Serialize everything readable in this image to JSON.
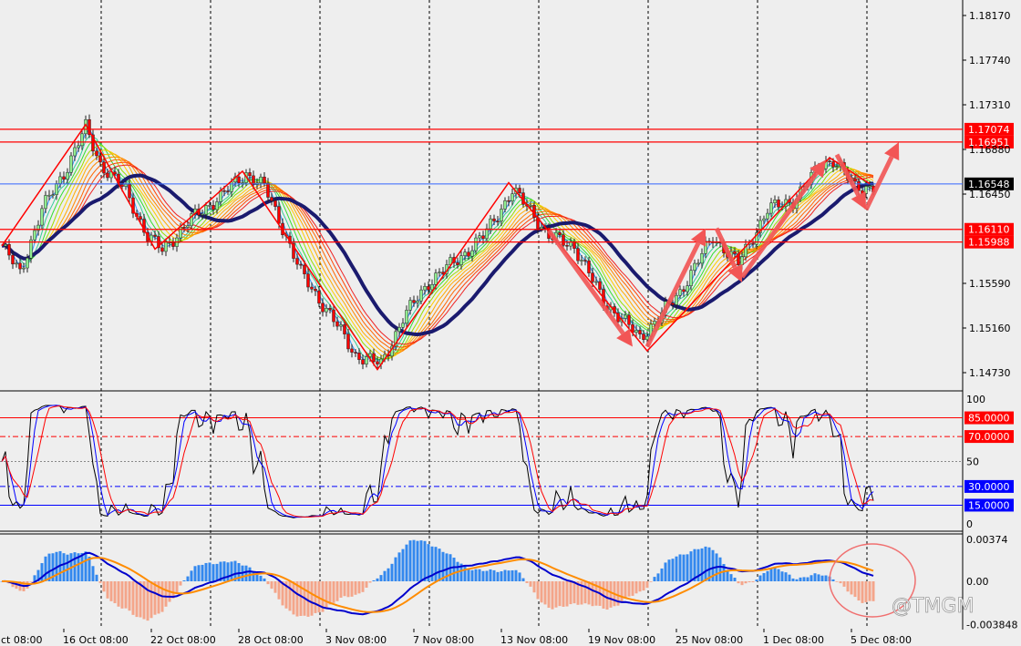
{
  "chart_data": [
    {
      "type": "candlestick",
      "panel": "price",
      "x_unit": "4-hour bar index",
      "y_ticks": [
        "1.18170",
        "1.17740",
        "1.17310",
        "1.16880",
        "1.16450",
        "1.15590",
        "1.15160",
        "1.14730"
      ],
      "ylim": [
        1.144,
        1.185
      ],
      "close_path": [
        [
          0,
          1.1595
        ],
        [
          5,
          1.1569
        ],
        [
          11,
          1.163
        ],
        [
          17,
          1.1665
        ],
        [
          23,
          1.1709
        ],
        [
          27,
          1.1674
        ],
        [
          34,
          1.1648
        ],
        [
          40,
          1.1604
        ],
        [
          44,
          1.1591
        ],
        [
          52,
          1.1621
        ],
        [
          60,
          1.1643
        ],
        [
          67,
          1.1665
        ],
        [
          72,
          1.1652
        ],
        [
          77,
          1.1613
        ],
        [
          82,
          1.1569
        ],
        [
          90,
          1.1529
        ],
        [
          97,
          1.149
        ],
        [
          104,
          1.1481
        ],
        [
          110,
          1.1525
        ],
        [
          117,
          1.156
        ],
        [
          125,
          1.1582
        ],
        [
          132,
          1.1604
        ],
        [
          140,
          1.1648
        ],
        [
          145,
          1.163
        ],
        [
          150,
          1.1604
        ],
        [
          157,
          1.1595
        ],
        [
          165,
          1.1542
        ],
        [
          175,
          1.1507
        ],
        [
          180,
          1.1525
        ],
        [
          186,
          1.1551
        ],
        [
          195,
          1.1604
        ],
        [
          202,
          1.1578
        ],
        [
          210,
          1.163
        ],
        [
          217,
          1.1639
        ],
        [
          225,
          1.1674
        ],
        [
          228,
          1.1678
        ],
        [
          234,
          1.1652
        ],
        [
          239,
          1.1652
        ]
      ],
      "current_price": {
        "label": "1.16548",
        "value": 1.16548,
        "color": "#000000",
        "line_color": "#3366ff"
      },
      "levels": [
        {
          "label": "1.17074",
          "value": 1.17074,
          "color": "#ff0000"
        },
        {
          "label": "1.16951",
          "value": 1.16951,
          "color": "#ff0000"
        },
        {
          "label": "1.16110",
          "value": 1.1611,
          "color": "#ff0000"
        },
        {
          "label": "1.15988",
          "value": 1.15988,
          "color": "#ff0000"
        }
      ],
      "zigzag": [
        [
          0,
          1.1595
        ],
        [
          23,
          1.1712
        ],
        [
          42,
          1.1592
        ],
        [
          66,
          1.1667
        ],
        [
          103,
          1.1476
        ],
        [
          139,
          1.1656
        ],
        [
          177,
          1.1494
        ],
        [
          227,
          1.168
        ],
        [
          238,
          1.1655
        ]
      ],
      "arrows": [
        [
          [
            150,
            1.161
          ],
          [
            173,
            1.1498
          ]
        ],
        [
          [
            177,
            1.1498
          ],
          [
            193,
            1.1612
          ]
        ],
        [
          [
            196,
            1.1612
          ],
          [
            203,
            1.156
          ]
        ],
        [
          [
            203,
            1.1565
          ],
          [
            226,
            1.1678
          ]
        ],
        [
          [
            229,
            1.1683
          ],
          [
            237,
            1.163
          ]
        ],
        [
          [
            237,
            1.163
          ],
          [
            246,
            1.1695
          ]
        ]
      ],
      "moving_average_color": "#1a1a6e",
      "bull_color": "#90ee90",
      "bear_color": "#ff0000"
    },
    {
      "type": "line",
      "panel": "stochastic",
      "ylim": [
        0,
        100
      ],
      "y_ticks": [
        "100",
        "50",
        "0"
      ],
      "levels": [
        {
          "label": "85.0000",
          "value": 85,
          "color": "#ff0000"
        },
        {
          "label": "70.0000",
          "value": 70,
          "color": "#ff0000"
        },
        {
          "label": "30.0000",
          "value": 30,
          "color": "#0000ff"
        },
        {
          "label": "15.0000",
          "value": 15,
          "color": "#0000ff"
        }
      ],
      "series_colors": [
        "#000000",
        "#0000ff",
        "#ff0000"
      ]
    },
    {
      "type": "bar",
      "panel": "macd",
      "y_ticks": [
        "0.00374",
        "0.00",
        "-0.003848"
      ],
      "ylim": [
        -0.003848,
        0.00374
      ],
      "histogram_colors": {
        "positive": "#3388ee",
        "negative": "#f4a58a"
      },
      "line_colors": [
        "#0000cc",
        "#ff8c00"
      ]
    }
  ],
  "x_axis": {
    "labels": [
      {
        "text": "ct 08:00",
        "bar": -7
      },
      {
        "text": "16 Oct 08:00",
        "bar": 17
      },
      {
        "text": "22 Oct 08:00",
        "bar": 41
      },
      {
        "text": "28 Oct 08:00",
        "bar": 65
      },
      {
        "text": "3 Nov 08:00",
        "bar": 89
      },
      {
        "text": "7 Nov 08:00",
        "bar": 113
      },
      {
        "text": "13 Nov 08:00",
        "bar": 137
      },
      {
        "text": "19 Nov 08:00",
        "bar": 161
      },
      {
        "text": "25 Nov 08:00",
        "bar": 185
      },
      {
        "text": "1 Dec 08:00",
        "bar": 209
      },
      {
        "text": "5 Dec 08:00",
        "bar": 233
      }
    ]
  },
  "watermark": "@TMGM"
}
